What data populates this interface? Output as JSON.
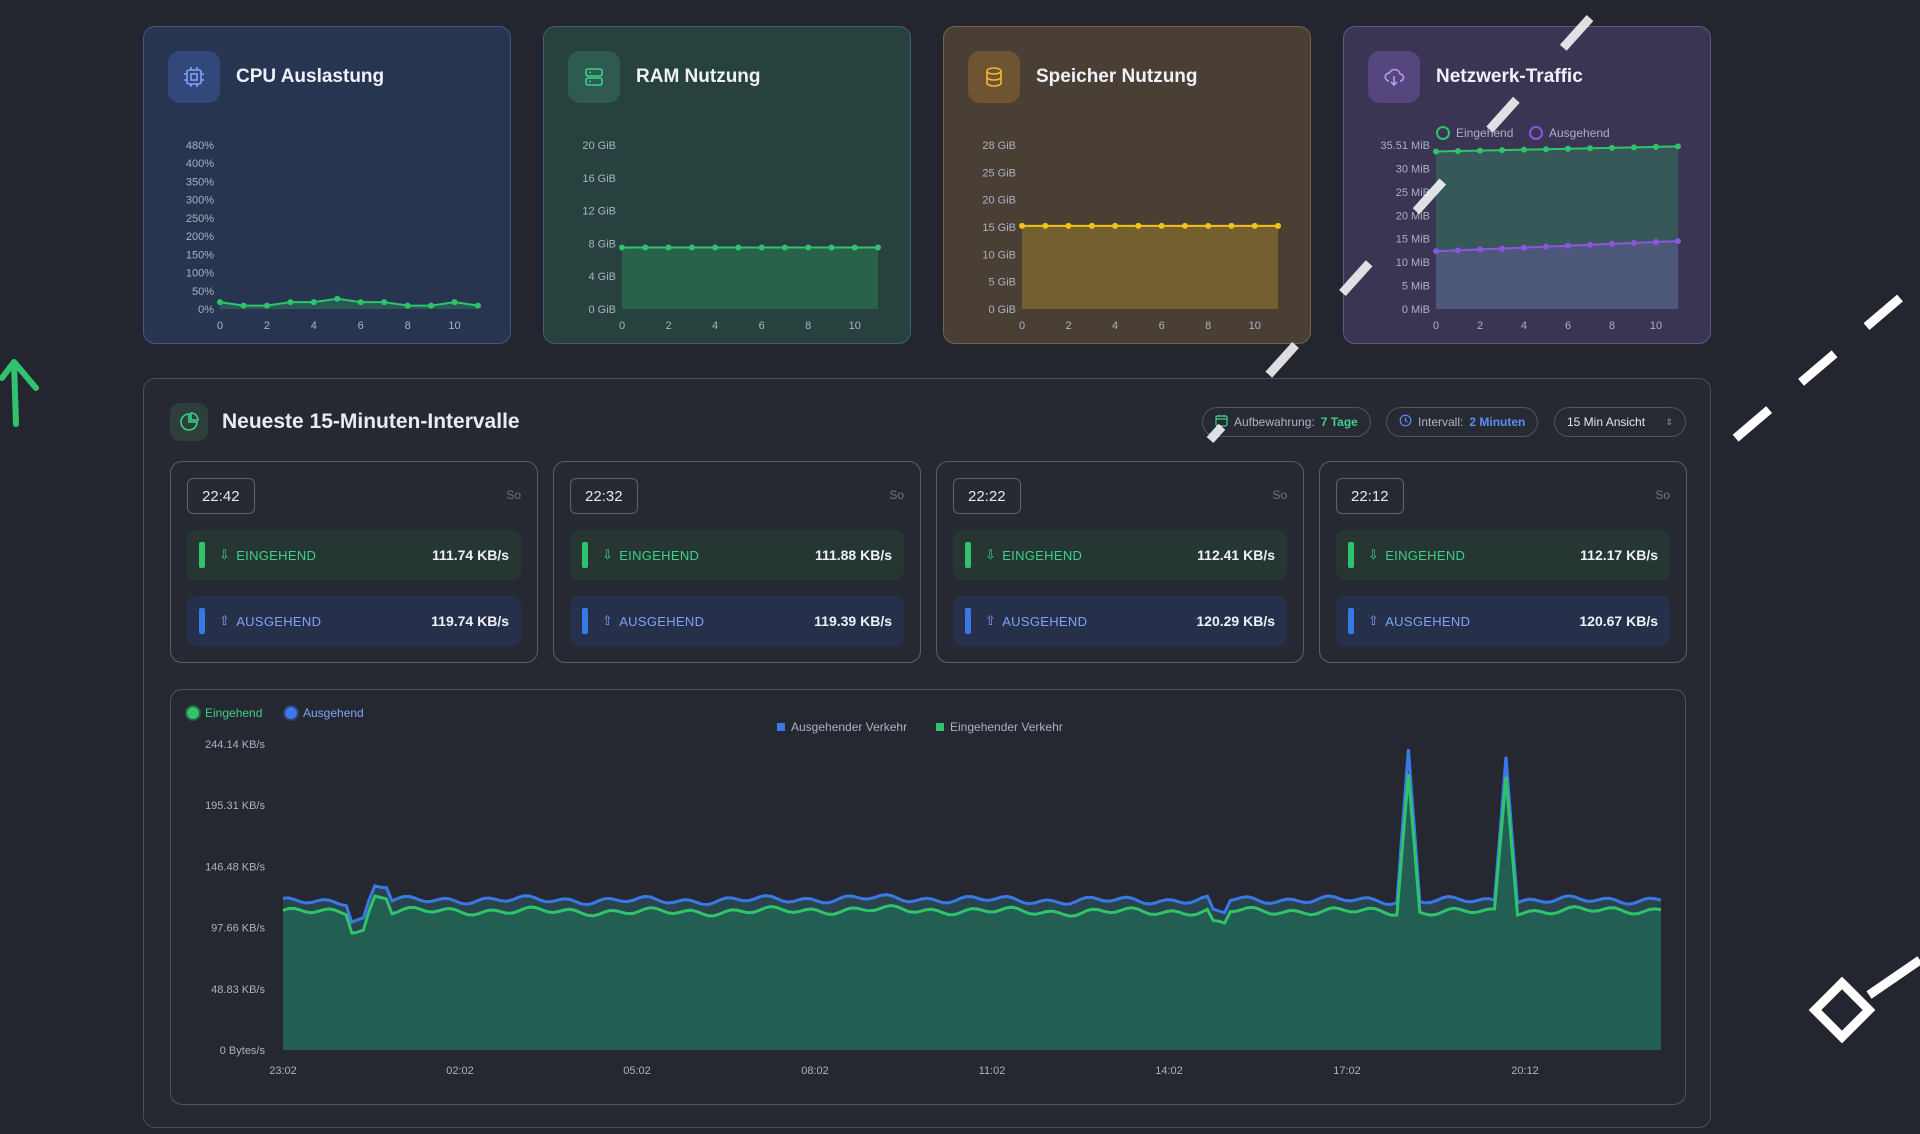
{
  "cards": {
    "cpu": {
      "title": "CPU Auslastung",
      "yticks": [
        "480%",
        "400%",
        "350%",
        "300%",
        "250%",
        "200%",
        "150%",
        "100%",
        "50%",
        "0%"
      ],
      "xticks": [
        "0",
        "2",
        "4",
        "6",
        "8",
        "10"
      ],
      "values": [
        2,
        1,
        1,
        2,
        2,
        3,
        2,
        2,
        1,
        1,
        2,
        1
      ]
    },
    "ram": {
      "title": "RAM Nutzung",
      "yticks": [
        "20 GiB",
        "16 GiB",
        "12 GiB",
        "8 GiB",
        "4 GiB",
        "0 GiB"
      ],
      "xticks": [
        "0",
        "2",
        "4",
        "6",
        "8",
        "10"
      ],
      "values": [
        7.5,
        7.5,
        7.5,
        7.5,
        7.5,
        7.5,
        7.5,
        7.5,
        7.5,
        7.5,
        7.5,
        7.5
      ]
    },
    "disk": {
      "title": "Speicher Nutzung",
      "yticks": [
        "28 GiB",
        "25 GiB",
        "20 GiB",
        "15 GiB",
        "10 GiB",
        "5 GiB",
        "0 GiB"
      ],
      "xticks": [
        "0",
        "2",
        "4",
        "6",
        "8",
        "10"
      ],
      "values": [
        14.2,
        14.2,
        14.2,
        14.2,
        14.2,
        14.2,
        14.2,
        14.2,
        14.2,
        14.2,
        14.2,
        14.2
      ]
    },
    "net": {
      "title": "Netzwerk-Traffic",
      "legend_in": "Eingehend",
      "legend_out": "Ausgehend",
      "yticks": [
        "35.51 MiB",
        "30 MiB",
        "25 MiB",
        "20 MiB",
        "15 MiB",
        "10 MiB",
        "5 MiB",
        "0 MiB"
      ],
      "xticks": [
        "0",
        "2",
        "4",
        "6",
        "8",
        "10"
      ],
      "in_values": [
        34.1,
        34.2,
        34.3,
        34.4,
        34.5,
        34.6,
        34.7,
        34.8,
        34.9,
        35.0,
        35.1,
        35.2
      ],
      "out_values": [
        12.5,
        12.7,
        12.9,
        13.1,
        13.3,
        13.5,
        13.7,
        13.9,
        14.1,
        14.3,
        14.5,
        14.7
      ]
    }
  },
  "panel": {
    "title": "Neueste 15-Minuten-Intervalle",
    "retention_label": "Aufbewahrung:",
    "retention_value": "7 Tage",
    "interval_label": "Intervall:",
    "interval_value": "2 Minuten",
    "view_select": "15 Min Ansicht"
  },
  "intervals": [
    {
      "time": "22:42",
      "day": "So",
      "in_label": "EINGEHEND",
      "in_value": "111.74 KB/s",
      "out_label": "AUSGEHEND",
      "out_value": "119.74 KB/s"
    },
    {
      "time": "22:32",
      "day": "So",
      "in_label": "EINGEHEND",
      "in_value": "111.88 KB/s",
      "out_label": "AUSGEHEND",
      "out_value": "119.39 KB/s"
    },
    {
      "time": "22:22",
      "day": "So",
      "in_label": "EINGEHEND",
      "in_value": "112.41 KB/s",
      "out_label": "AUSGEHEND",
      "out_value": "120.29 KB/s"
    },
    {
      "time": "22:12",
      "day": "So",
      "in_label": "EINGEHEND",
      "in_value": "112.17 KB/s",
      "out_label": "AUSGEHEND",
      "out_value": "120.67 KB/s"
    }
  ],
  "traffic_chart": {
    "legend_in": "Eingehend",
    "legend_out": "Ausgehend",
    "series_legend_out": "Ausgehender Verkehr",
    "series_legend_in": "Eingehender Verkehr",
    "yticks": [
      "244.14 KB/s",
      "195.31 KB/s",
      "146.48 KB/s",
      "97.66 KB/s",
      "48.83 KB/s",
      "0 Bytes/s"
    ],
    "xticks": [
      "23:02",
      "02:02",
      "05:02",
      "08:02",
      "11:02",
      "14:02",
      "17:02",
      "20:12"
    ]
  },
  "chart_data": {
    "type": "area",
    "ylim": [
      0,
      244.14
    ],
    "x": [
      "23:02",
      "02:02",
      "05:02",
      "08:02",
      "11:02",
      "14:02",
      "17:02",
      "20:12"
    ],
    "series": [
      {
        "name": "Ausgehender Verkehr",
        "values": [
          118,
          120,
          119,
          121,
          119,
          120,
          119,
          120
        ]
      },
      {
        "name": "Eingehender Verkehr",
        "values": [
          110,
          111,
          110,
          112,
          110,
          111,
          110,
          112
        ]
      }
    ],
    "spikes": [
      {
        "x": "18:40",
        "ausgehend": 240,
        "eingehend": 220
      },
      {
        "x": "20:40",
        "ausgehend": 234,
        "eingehend": 218
      }
    ],
    "color_in": "#2fc46b",
    "color_out": "#3b78e7"
  }
}
